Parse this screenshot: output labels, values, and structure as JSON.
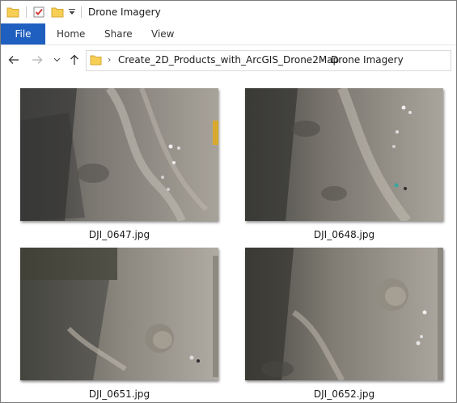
{
  "window": {
    "title": "Drone Imagery"
  },
  "quick_access": {
    "icons": [
      "folder-icon",
      "properties-checkmark-icon",
      "new-folder-icon",
      "customize-dropdown-icon"
    ]
  },
  "ribbon": {
    "tabs": [
      {
        "label": "File",
        "active": true
      },
      {
        "label": "Home"
      },
      {
        "label": "Share"
      },
      {
        "label": "View"
      }
    ],
    "accent": "#1f5fbf"
  },
  "navigation": {
    "breadcrumb": [
      "Create_2D_Products_with_ArcGIS_Drone2Map",
      "Drone Imagery"
    ]
  },
  "files": [
    {
      "name": "DJI_0647.jpg"
    },
    {
      "name": "DJI_0648.jpg"
    },
    {
      "name": "DJI_0651.jpg"
    },
    {
      "name": "DJI_0652.jpg"
    }
  ]
}
